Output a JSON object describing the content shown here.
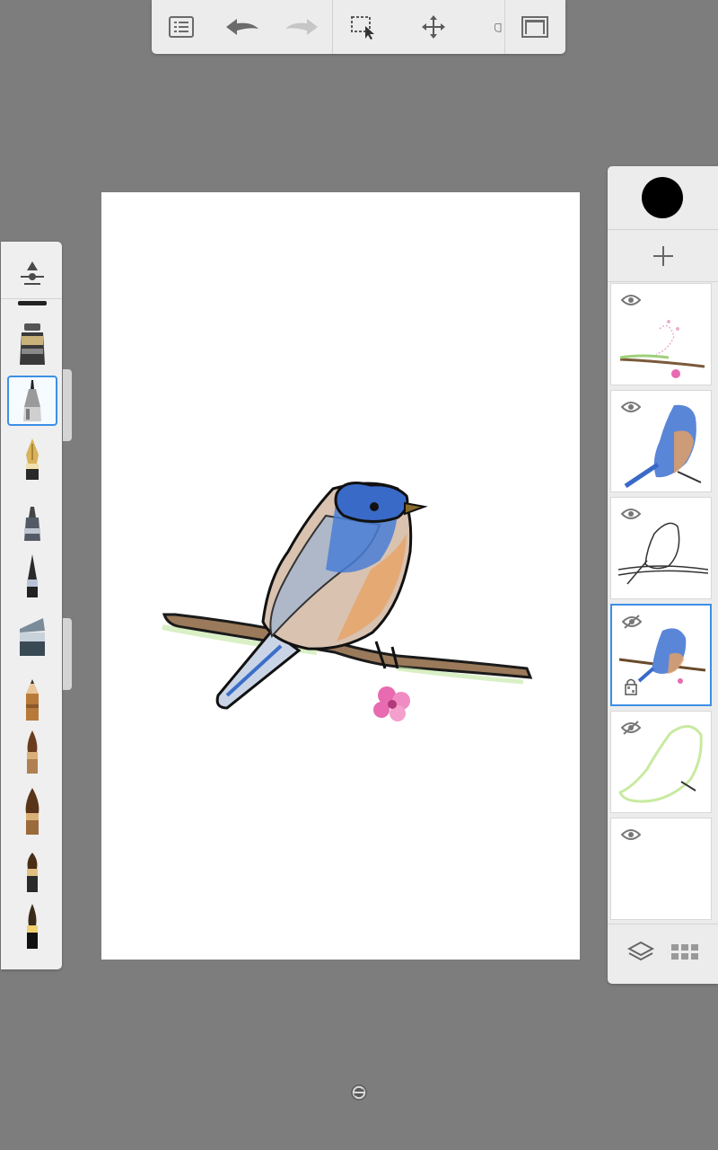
{
  "app": {
    "colors": {
      "background": "#7d7d7d",
      "panel": "#ececec",
      "accent": "#3d8fe6",
      "current_color": "#000000"
    }
  },
  "toolbar": {
    "tools": [
      {
        "icon": "list-icon"
      },
      {
        "icon": "undo-icon"
      },
      {
        "icon": "redo-icon",
        "state": "disabled"
      },
      {
        "icon": "selection-icon"
      },
      {
        "icon": "move-icon"
      },
      {
        "icon": "fill-bucket-icon"
      },
      {
        "icon": "canvas-view-icon"
      }
    ]
  },
  "brushes": {
    "selected_index": 2,
    "items": [
      {
        "icon": "brush-properties-icon"
      },
      {
        "icon": "ballpoint-pen-icon"
      },
      {
        "icon": "technical-pen-icon",
        "selected": true
      },
      {
        "icon": "fountain-pen-icon"
      },
      {
        "icon": "felt-tip-marker-icon"
      },
      {
        "icon": "fine-brush-icon"
      },
      {
        "icon": "chisel-marker-icon"
      },
      {
        "icon": "pencil-icon"
      },
      {
        "icon": "round-brush-icon"
      },
      {
        "icon": "flat-brush-icon"
      },
      {
        "icon": "watercolor-brush-icon"
      },
      {
        "icon": "ink-brush-icon"
      }
    ]
  },
  "canvas": {
    "subject": "bluebird-on-branch-drawing"
  },
  "layers": {
    "items": [
      {
        "thumbnail": "blossom-sketch",
        "visible": true
      },
      {
        "thumbnail": "bird-color",
        "visible": true
      },
      {
        "thumbnail": "bird-outline",
        "visible": true
      },
      {
        "thumbnail": "bird-composite",
        "visible": false,
        "selected": true,
        "locked": true
      },
      {
        "thumbnail": "green-guide-sketch",
        "visible": false
      },
      {
        "thumbnail": "empty",
        "visible": true
      }
    ],
    "actions": [
      {
        "icon": "add-layer-icon"
      },
      {
        "icon": "layer-stack-icon"
      },
      {
        "icon": "grid-icon"
      }
    ]
  }
}
